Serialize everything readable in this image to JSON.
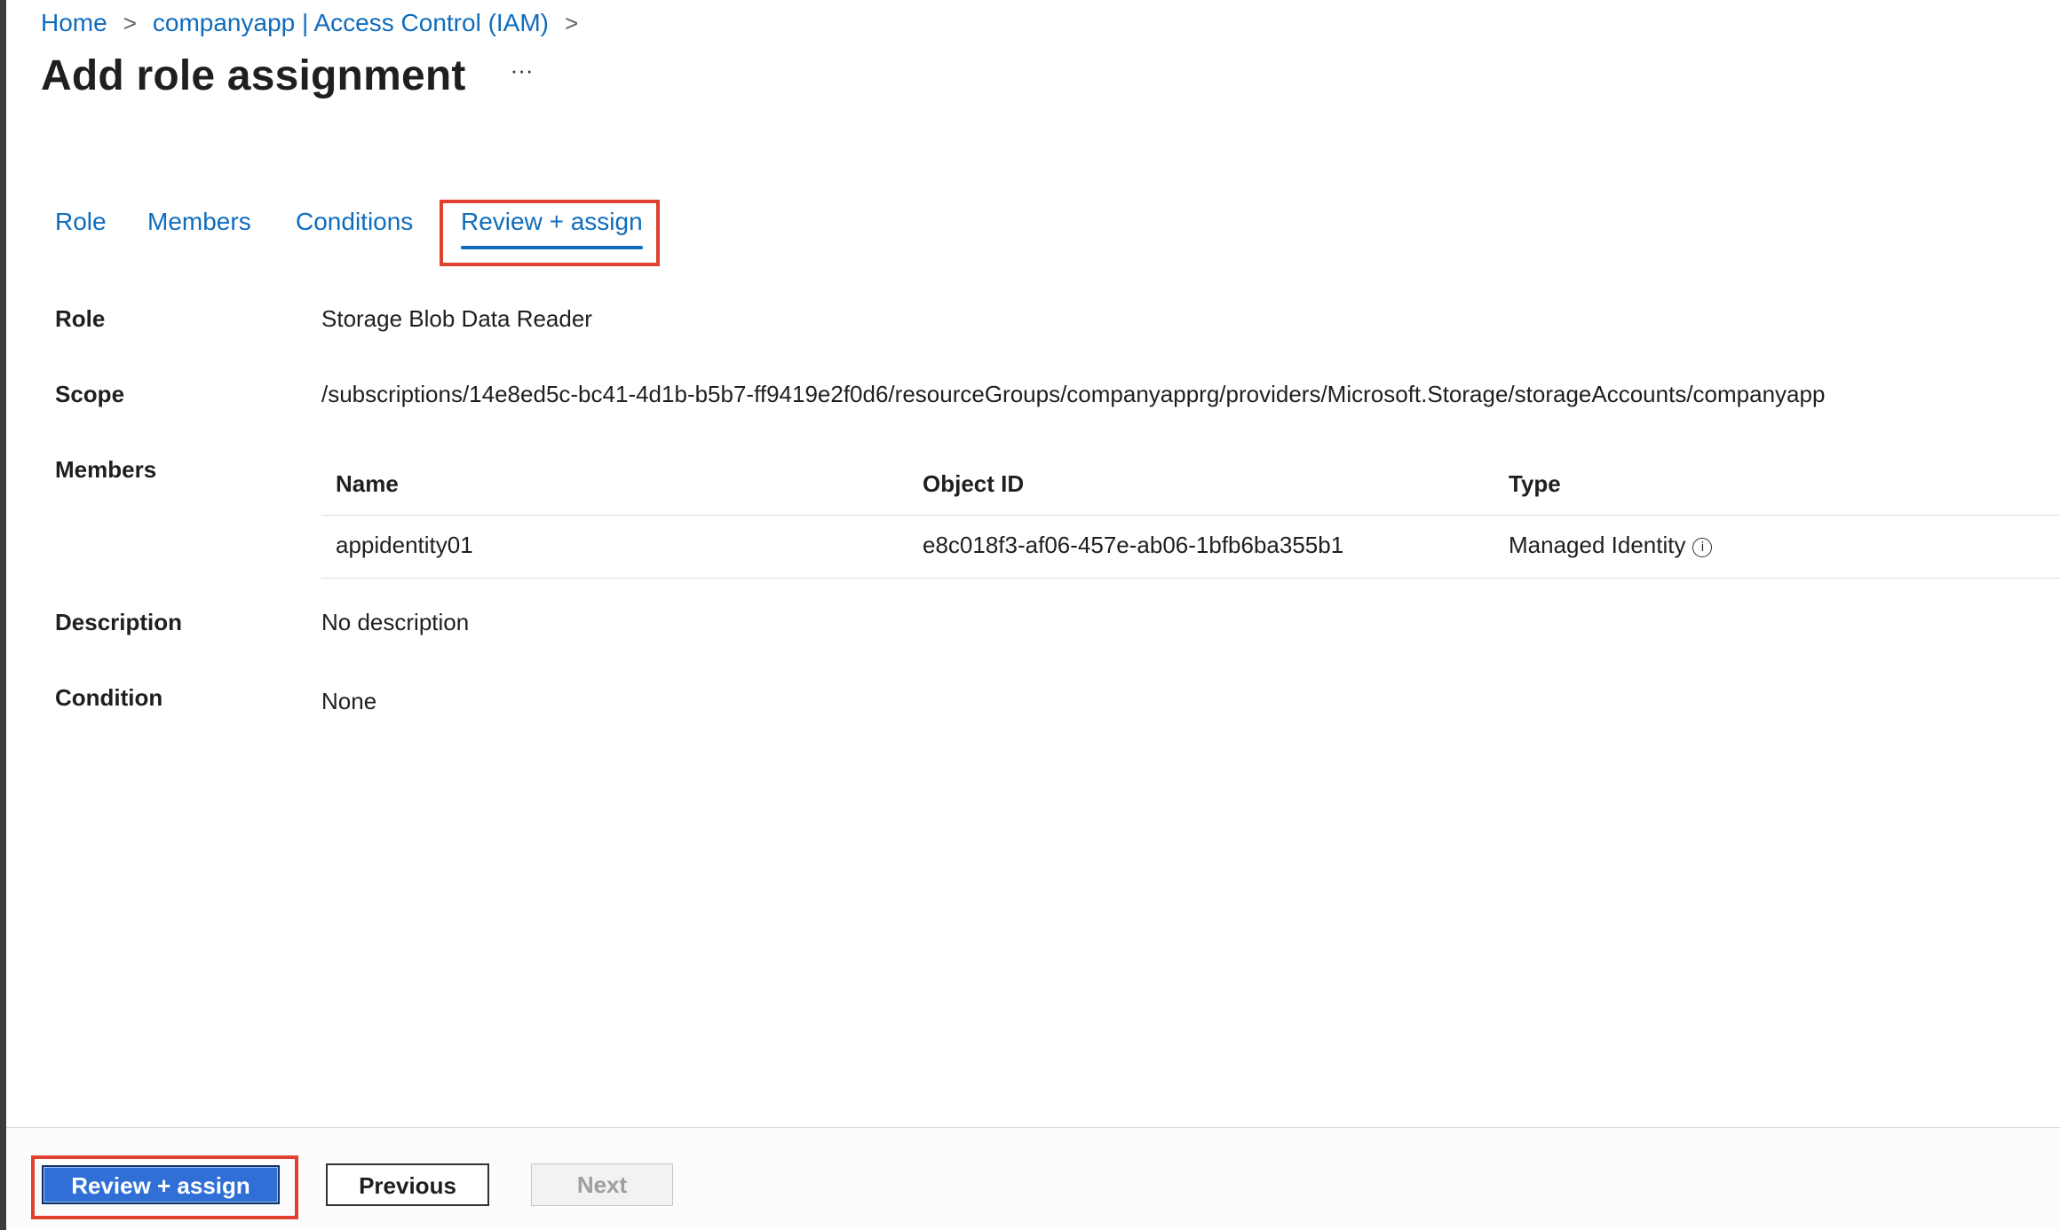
{
  "breadcrumb": {
    "home": "Home",
    "separator": ">",
    "resource": "companyapp | Access Control (IAM)"
  },
  "header": {
    "title": "Add role assignment",
    "more": "···"
  },
  "tabs": [
    {
      "label": "Role"
    },
    {
      "label": "Members"
    },
    {
      "label": "Conditions"
    },
    {
      "label": "Review + assign",
      "active": true
    }
  ],
  "review": {
    "role_label": "Role",
    "role_value": "Storage Blob Data Reader",
    "scope_label": "Scope",
    "scope_value": "/subscriptions/14e8ed5c-bc41-4d1b-b5b7-ff9419e2f0d6/resourceGroups/companyapprg/providers/Microsoft.Storage/storageAccounts/companyapp",
    "members_label": "Members",
    "description_label": "Description",
    "description_value": "No description",
    "condition_label": "Condition",
    "condition_value": "None"
  },
  "members_table": {
    "columns": [
      "Name",
      "Object ID",
      "Type"
    ],
    "rows": [
      [
        "appidentity01",
        "e8c018f3-af06-457e-ab06-1bfb6ba355b1",
        "Managed Identity"
      ]
    ],
    "info_icon": "i"
  },
  "footer": {
    "primary": "Review + assign",
    "previous": "Previous",
    "next": "Next"
  },
  "colors": {
    "link": "#0f6cbd",
    "primary_button": "#2f6fd6",
    "highlight": "#e0412f"
  }
}
